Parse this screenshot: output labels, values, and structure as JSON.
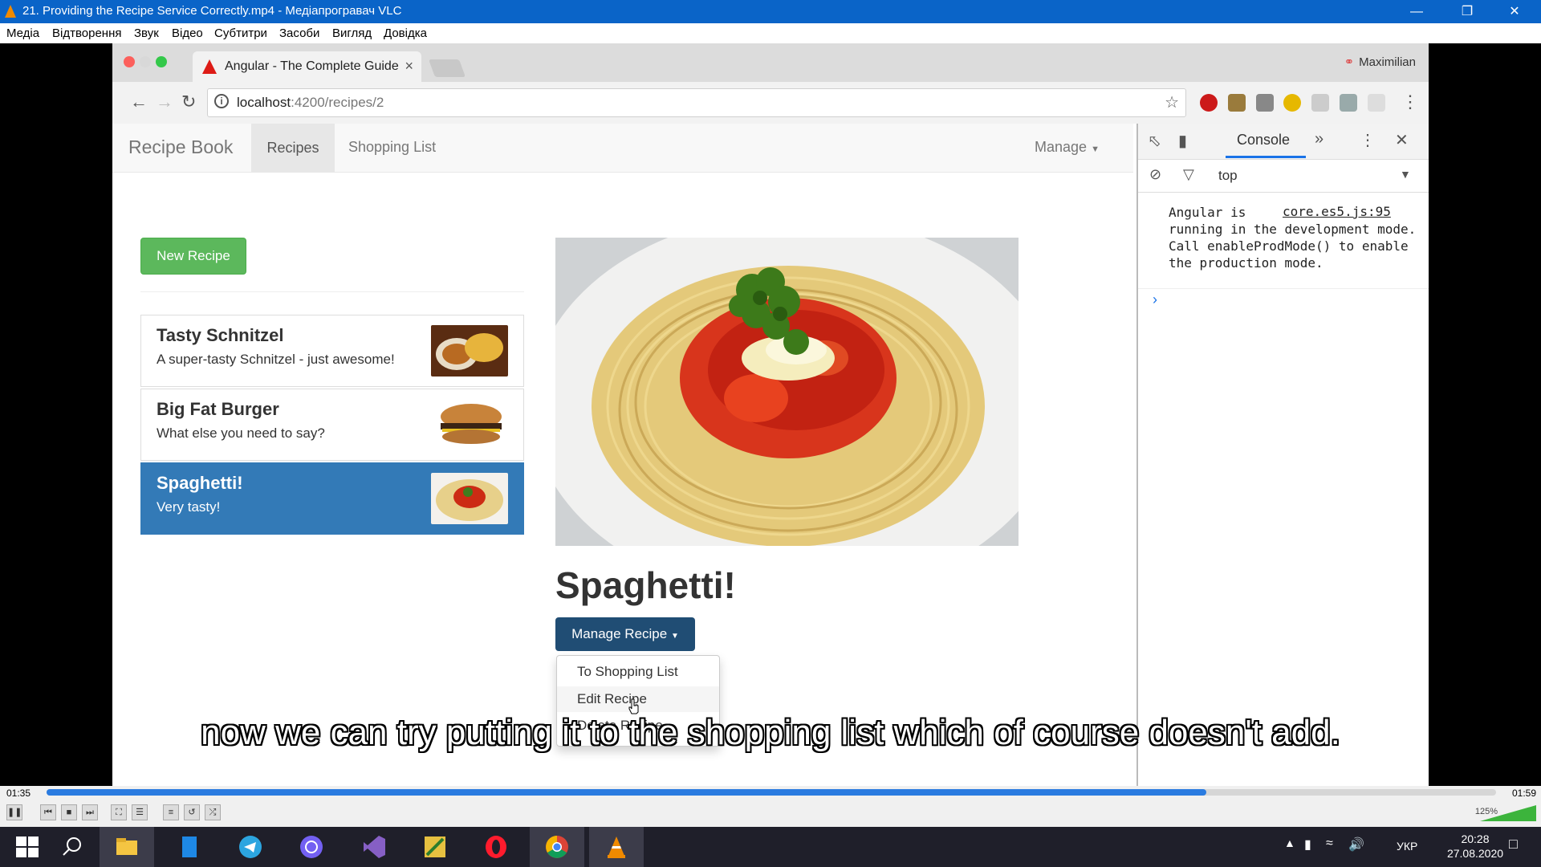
{
  "vlc": {
    "window_title": "21. Providing the Recipe Service Correctly.mp4 - Медіапрогравач VLC",
    "menu": [
      "Медіа",
      "Відтворення",
      "Звук",
      "Відео",
      "Субтитри",
      "Засоби",
      "Вигляд",
      "Довідка"
    ],
    "time_current": "01:35",
    "time_total": "01:59",
    "progress": 0.8,
    "volume_label": "125%",
    "subtitle": "now we can try putting it to the shopping list which of course doesn't add."
  },
  "browser": {
    "tab_title": "Angular - The Complete Guide",
    "profile_name": "Maximilian",
    "url_host": "localhost",
    "url_path": ":4200/recipes/2"
  },
  "app": {
    "brand": "Recipe Book",
    "nav": {
      "recipes": "Recipes",
      "shopping_list": "Shopping List",
      "manage": "Manage"
    },
    "new_recipe_label": "New Recipe",
    "recipes": [
      {
        "name": "Tasty Schnitzel",
        "description": "A super-tasty Schnitzel - just awesome!",
        "active": false
      },
      {
        "name": "Big Fat Burger",
        "description": "What else you need to say?",
        "active": false
      },
      {
        "name": "Spaghetti!",
        "description": "Very tasty!",
        "active": true
      }
    ],
    "detail": {
      "title": "Spaghetti!",
      "manage_button": "Manage Recipe",
      "dropdown": [
        "To Shopping List",
        "Edit Recipe",
        "Delete Recipe"
      ]
    }
  },
  "devtools": {
    "tab": "Console",
    "context": "top",
    "message": "Angular is running in the development mode. Call enableProdMode() to enable the production mode.",
    "message_start": "Angular is",
    "message_rest": "running in the development mode. Call enableProdMode() to enable the production mode.",
    "source": "core.es5.js:95"
  },
  "taskbar": {
    "language": "УКР",
    "time": "20:28",
    "date": "27.08.2020"
  },
  "colors": {
    "vlc_title": "#0a64c8",
    "new_recipe": "#5cb85c",
    "active_item": "#337ab7",
    "manage_btn": "#204d74"
  }
}
